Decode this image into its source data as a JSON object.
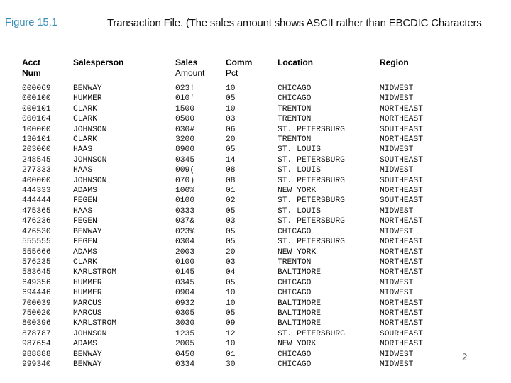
{
  "figure_label": "Figure 15.1",
  "title": "Transaction File. (The sales amount shows ASCII rather than EBCDIC Characters",
  "page_number": "2",
  "colors": {
    "figure_label": "#3a8fb7",
    "text": "#111111"
  },
  "table": {
    "headers": [
      {
        "line1": "Acct",
        "line2": "Num",
        "line2_bold": true
      },
      {
        "line1": "Salesperson",
        "line2": "",
        "line2_bold": false
      },
      {
        "line1": "Sales",
        "line2": "Amount",
        "line2_bold": false
      },
      {
        "line1": "Comm",
        "line2": "Pct",
        "line2_bold": false
      },
      {
        "line1": "Location",
        "line2": "",
        "line2_bold": false
      },
      {
        "line1": "Region",
        "line2": "",
        "line2_bold": false
      }
    ],
    "rows": [
      [
        "000069",
        "BENWAY",
        "023!",
        "10",
        "CHICAGO",
        "MIDWEST"
      ],
      [
        "000100",
        "HUMMER",
        "010'",
        "05",
        "CHICAGO",
        "MIDWEST"
      ],
      [
        "000101",
        "CLARK",
        "1500",
        "10",
        "TRENTON",
        "NORTHEAST"
      ],
      [
        "000104",
        "CLARK",
        "0500",
        "03",
        "TRENTON",
        "NORTHEAST"
      ],
      [
        "100000",
        "JOHNSON",
        "030#",
        "06",
        "ST. PETERSBURG",
        "SOUTHEAST"
      ],
      [
        "130101",
        "CLARK",
        "3200",
        "20",
        "TRENTON",
        "NORTHEAST"
      ],
      [
        "203000",
        "HAAS",
        "8900",
        "05",
        "ST. LOUIS",
        "MIDWEST"
      ],
      [
        "248545",
        "JOHNSON",
        "0345",
        "14",
        "ST. PETERSBURG",
        "SOUTHEAST"
      ],
      [
        "277333",
        "HAAS",
        "009(",
        "08",
        "ST. LOUIS",
        "MIDWEST"
      ],
      [
        "400000",
        "JOHNSON",
        "070)",
        "08",
        "ST. PETERSBURG",
        "SOUTHEAST"
      ],
      [
        "444333",
        "ADAMS",
        "100%",
        "01",
        "NEW YORK",
        "NORTHEAST"
      ],
      [
        "444444",
        "FEGEN",
        "0100",
        "02",
        "ST. PETERSBURG",
        "SOUTHEAST"
      ],
      [
        "475365",
        "HAAS",
        "0333",
        "05",
        "ST. LOUIS",
        "MIDWEST"
      ],
      [
        "476236",
        "FEGEN",
        "037&",
        "03",
        "ST. PETERSBURG",
        "NORTHEAST"
      ],
      [
        "476530",
        "BENWAY",
        "023%",
        "05",
        "CHICAGO",
        "MIDWEST"
      ],
      [
        "555555",
        "FEGEN",
        "0304",
        "05",
        "ST. PETERSBURG",
        "NORTHEAST"
      ],
      [
        "555666",
        "ADAMS",
        "2003",
        "20",
        "NEW YORK",
        "NORTHEAST"
      ],
      [
        "576235",
        "CLARK",
        "0100",
        "03",
        "TRENTON",
        "NORTHEAST"
      ],
      [
        "583645",
        "KARLSTROM",
        "0145",
        "04",
        "BALTIMORE",
        "NORTHEAST"
      ],
      [
        "649356",
        "HUMMER",
        "0345",
        "05",
        "CHICAGO",
        "MIDWEST"
      ],
      [
        "694446",
        "HUMMER",
        "0904",
        "10",
        "CHICAGO",
        "MIDWEST"
      ],
      [
        "700039",
        "MARCUS",
        "0932",
        "10",
        "BALTIMORE",
        "NORTHEAST"
      ],
      [
        "750020",
        "MARCUS",
        "0305",
        "05",
        "BALTIMORE",
        "NORTHEAST"
      ],
      [
        "800396",
        "KARLSTROM",
        "3030",
        "09",
        "BALTIMORE",
        "NORTHEAST"
      ],
      [
        "878787",
        "JOHNSON",
        "1235",
        "12",
        "ST. PETERSBURG",
        "SOURHEAST"
      ],
      [
        "987654",
        "ADAMS",
        "2005",
        "10",
        "NEW YORK",
        "NORTHEAST"
      ],
      [
        "988888",
        "BENWAY",
        "0450",
        "01",
        "CHICAGO",
        "MIDWEST"
      ],
      [
        "999340",
        "BENWAY",
        "0334",
        "30",
        "CHICAGO",
        "MIDWEST"
      ]
    ]
  }
}
